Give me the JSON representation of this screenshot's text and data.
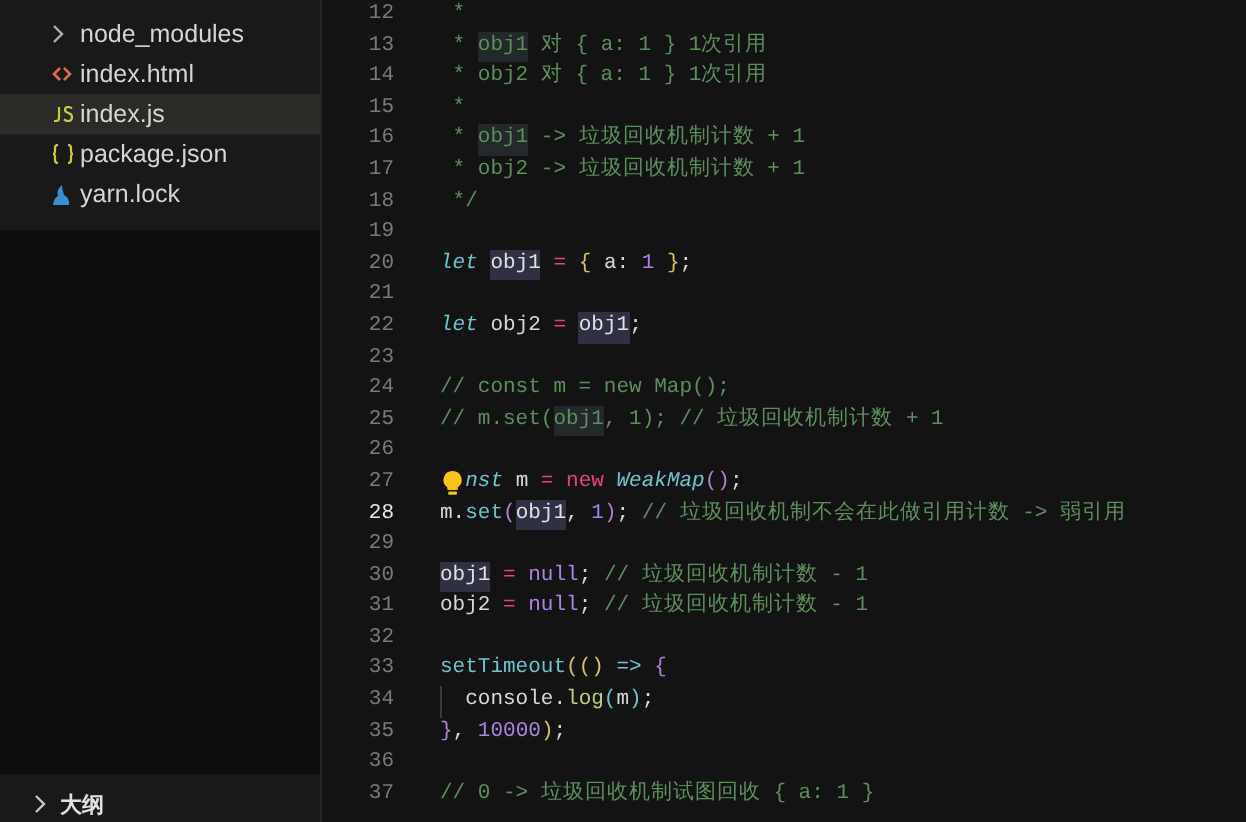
{
  "sidebar": {
    "items": [
      {
        "label": "node_modules",
        "kind": "folder",
        "selected": false
      },
      {
        "label": "index.html",
        "kind": "html",
        "selected": false
      },
      {
        "label": "index.js",
        "kind": "js",
        "selected": true
      },
      {
        "label": "package.json",
        "kind": "json",
        "selected": false
      },
      {
        "label": "yarn.lock",
        "kind": "yarn",
        "selected": false
      }
    ],
    "outline": {
      "label": "大纲",
      "expanded": false
    }
  },
  "editor": {
    "lines": [
      {
        "n": "12",
        "current": false,
        "tokens": [
          {
            "text": " *",
            "kind": "comment"
          }
        ]
      },
      {
        "n": "13",
        "current": false,
        "tokens": [
          {
            "text": " * ",
            "kind": "comment"
          },
          {
            "text": "obj1",
            "kind": "commenthl"
          },
          {
            "text": " 对 { a: 1 } 1次引用",
            "kind": "comment"
          }
        ]
      },
      {
        "n": "14",
        "current": false,
        "tokens": [
          {
            "text": " * obj2 对 { a: 1 } 1次引用",
            "kind": "comment"
          }
        ]
      },
      {
        "n": "15",
        "current": false,
        "tokens": [
          {
            "text": " *",
            "kind": "comment"
          }
        ]
      },
      {
        "n": "16",
        "current": false,
        "tokens": [
          {
            "text": " * ",
            "kind": "comment"
          },
          {
            "text": "obj1",
            "kind": "commenthl"
          },
          {
            "text": " -> 垃圾回收机制计数 + 1",
            "kind": "comment"
          }
        ]
      },
      {
        "n": "17",
        "current": false,
        "tokens": [
          {
            "text": " * obj2 -> 垃圾回收机制计数 + 1",
            "kind": "comment"
          }
        ]
      },
      {
        "n": "18",
        "current": false,
        "tokens": [
          {
            "text": " */",
            "kind": "comment"
          }
        ]
      },
      {
        "n": "19",
        "current": false
      },
      {
        "n": "20",
        "current": false,
        "tokens": [
          {
            "text": "let ",
            "kind": "keyword"
          },
          {
            "text": "obj1",
            "kind": "highlight"
          },
          {
            "text": " = ",
            "kind": "operator"
          },
          {
            "text": "{ ",
            "kind": "brace"
          },
          {
            "text": "a: ",
            "kind": "plain"
          },
          {
            "text": "1 ",
            "kind": "number"
          },
          {
            "text": "}",
            "kind": "brace"
          },
          {
            "text": ";",
            "kind": "plain"
          }
        ]
      },
      {
        "n": "21",
        "current": false
      },
      {
        "n": "22",
        "current": false,
        "tokens": [
          {
            "text": "let ",
            "kind": "keyword"
          },
          {
            "text": "obj2",
            "kind": "plain"
          },
          {
            "text": " = ",
            "kind": "operator"
          },
          {
            "text": "obj1",
            "kind": "highlight"
          },
          {
            "text": ";",
            "kind": "plain"
          }
        ]
      },
      {
        "n": "23",
        "current": false
      },
      {
        "n": "24",
        "current": false,
        "tokens": [
          {
            "text": "// const m = new Map();",
            "kind": "comment"
          }
        ]
      },
      {
        "n": "25",
        "current": false,
        "tokens": [
          {
            "text": "// m.set(",
            "kind": "comment"
          },
          {
            "text": "obj1",
            "kind": "commenthl"
          },
          {
            "text": ", 1); // 垃圾回收机制计数 + 1",
            "kind": "comment"
          }
        ]
      },
      {
        "n": "26",
        "current": false
      },
      {
        "n": "27",
        "current": false,
        "tokens": [
          {
            "kind": "bulb"
          },
          {
            "text": "nst ",
            "kind": "keyword"
          },
          {
            "text": "m",
            "kind": "plain"
          },
          {
            "text": " = ",
            "kind": "operator"
          },
          {
            "text": "new ",
            "kind": "keyword2"
          },
          {
            "text": "WeakMap",
            "kind": "classname"
          },
          {
            "text": "()",
            "kind": "paren"
          },
          {
            "text": ";",
            "kind": "plain"
          }
        ]
      },
      {
        "n": "28",
        "current": true,
        "tokens": [
          {
            "text": "m.",
            "kind": "plain"
          },
          {
            "text": "set",
            "kind": "function"
          },
          {
            "text": "(",
            "kind": "paren"
          },
          {
            "text": "obj1",
            "kind": "highlight"
          },
          {
            "text": ", ",
            "kind": "plain"
          },
          {
            "text": "1",
            "kind": "number"
          },
          {
            "text": ")",
            "kind": "paren"
          },
          {
            "text": "; ",
            "kind": "plain"
          },
          {
            "text": "// 垃圾回收机制不会在此做引用计数 -> 弱引用",
            "kind": "comment"
          }
        ]
      },
      {
        "n": "29",
        "current": false
      },
      {
        "n": "30",
        "current": false,
        "tokens": [
          {
            "text": "obj1",
            "kind": "highlight"
          },
          {
            "text": " = ",
            "kind": "operator"
          },
          {
            "text": "null",
            "kind": "number"
          },
          {
            "text": "; ",
            "kind": "plain"
          },
          {
            "text": "// 垃圾回收机制计数 - 1",
            "kind": "comment"
          }
        ]
      },
      {
        "n": "31",
        "current": false,
        "tokens": [
          {
            "text": "obj2",
            "kind": "plain"
          },
          {
            "text": " = ",
            "kind": "operator"
          },
          {
            "text": "null",
            "kind": "number"
          },
          {
            "text": "; ",
            "kind": "plain"
          },
          {
            "text": "// 垃圾回收机制计数 - 1",
            "kind": "comment"
          }
        ]
      },
      {
        "n": "32",
        "current": false
      },
      {
        "n": "33",
        "current": false,
        "tokens": [
          {
            "text": "setTimeout",
            "kind": "function"
          },
          {
            "text": "(() ",
            "kind": "brace"
          },
          {
            "text": "=> ",
            "kind": "function"
          },
          {
            "text": "{",
            "kind": "paren"
          }
        ]
      },
      {
        "n": "34",
        "current": false,
        "tokens": [
          {
            "kind": "guide"
          },
          {
            "text": "console.",
            "kind": "plain"
          },
          {
            "text": "log",
            "kind": "method"
          },
          {
            "text": "(",
            "kind": "function"
          },
          {
            "text": "m",
            "kind": "plain"
          },
          {
            "text": ")",
            "kind": "function"
          },
          {
            "text": ";",
            "kind": "plain"
          }
        ]
      },
      {
        "n": "35",
        "current": false,
        "tokens": [
          {
            "text": "}",
            "kind": "paren"
          },
          {
            "text": ", ",
            "kind": "plain"
          },
          {
            "text": "10000",
            "kind": "number"
          },
          {
            "text": ")",
            "kind": "brace"
          },
          {
            "text": ";",
            "kind": "plain"
          }
        ]
      },
      {
        "n": "36",
        "current": false
      },
      {
        "n": "37",
        "current": false,
        "tokens": [
          {
            "text": "// 0 -> 垃圾回收机制试图回收 { a: 1 }",
            "kind": "comment"
          }
        ]
      }
    ]
  }
}
